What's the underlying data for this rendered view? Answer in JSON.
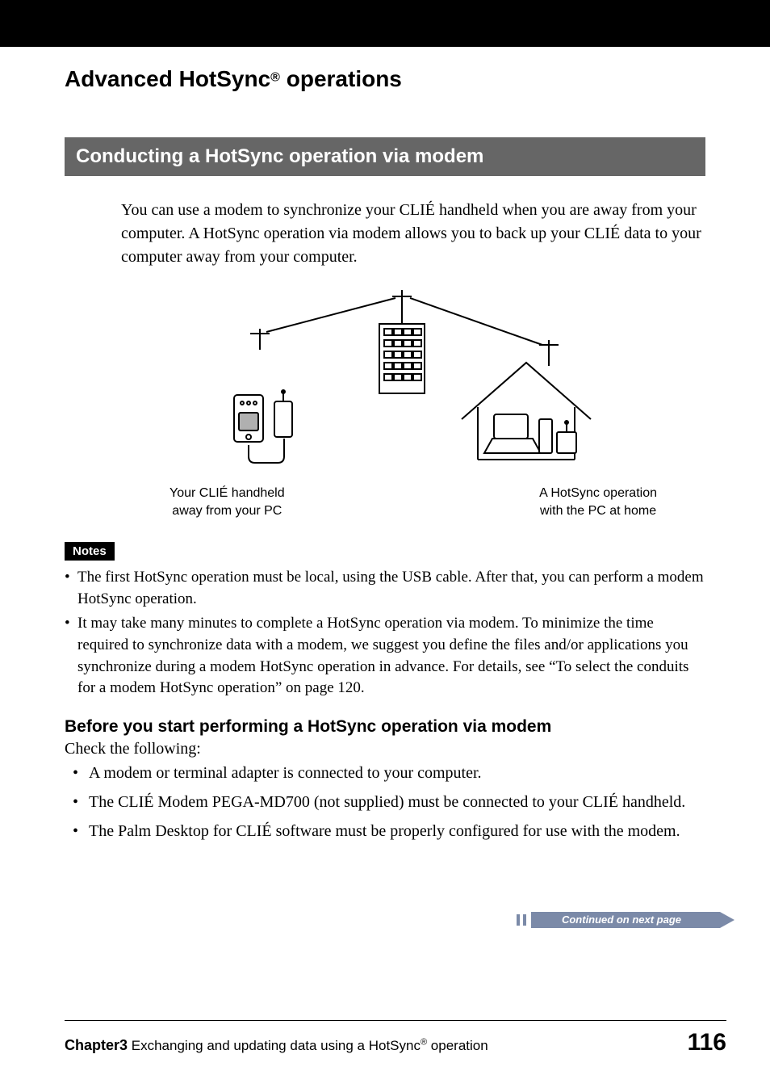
{
  "title": {
    "pre": "Advanced HotSync",
    "sup": "®",
    "post": " operations"
  },
  "section_heading": "Conducting a HotSync operation via modem",
  "intro": "You can use a modem to synchronize your CLIÉ handheld when you are away from your computer. A HotSync operation via modem allows you to back up your CLIÉ data to your computer away from your computer.",
  "diagram": {
    "left_caption_l1": "Your CLIÉ handheld",
    "left_caption_l2": "away from your PC",
    "right_caption_l1": "A HotSync operation",
    "right_caption_l2": "with the PC at home"
  },
  "notes_label": "Notes",
  "notes": [
    "The first HotSync operation must be local, using the USB cable. After that, you can perform a modem HotSync operation.",
    "It may take many minutes to complete a HotSync operation via modem. To minimize the time required to synchronize data with a modem, we suggest you define the files and/or applications you synchronize during a modem HotSync operation in advance. For details, see “To select the conduits for a modem HotSync operation” on page 120."
  ],
  "before_heading": "Before you start performing a HotSync operation via modem",
  "check_text": "Check the following:",
  "before_items": [
    "A modem or terminal adapter is connected to your computer.",
    "The CLIÉ Modem PEGA-MD700 (not supplied) must be connected to your CLIÉ handheld.",
    "The Palm Desktop for CLIÉ software must be properly configured for use with the modem."
  ],
  "continued": "Continued on next page",
  "footer": {
    "chapter_bold": "Chapter3",
    "chapter_rest_pre": "  Exchanging and updating data using a HotSync",
    "chapter_sup": "®",
    "chapter_rest_post": " operation",
    "page": "116"
  }
}
